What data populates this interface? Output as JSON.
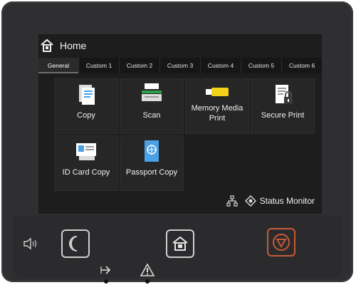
{
  "header": {
    "title": "Home"
  },
  "tabs": [
    "General",
    "Custom 1",
    "Custom 2",
    "Custom 3",
    "Custom 4",
    "Custom 5",
    "Custom 6"
  ],
  "tiles": [
    {
      "label": "Copy"
    },
    {
      "label": "Scan"
    },
    {
      "label": "Memory Media Print"
    },
    {
      "label": "Secure Print"
    },
    {
      "label": "ID Card Copy"
    },
    {
      "label": "Passport Copy"
    }
  ],
  "status": {
    "label": "Status Monitor"
  },
  "colors": {
    "accent_yellow": "#f3d21b",
    "accent_blue": "#4aa1e6",
    "stop_orange": "#c85a38"
  }
}
